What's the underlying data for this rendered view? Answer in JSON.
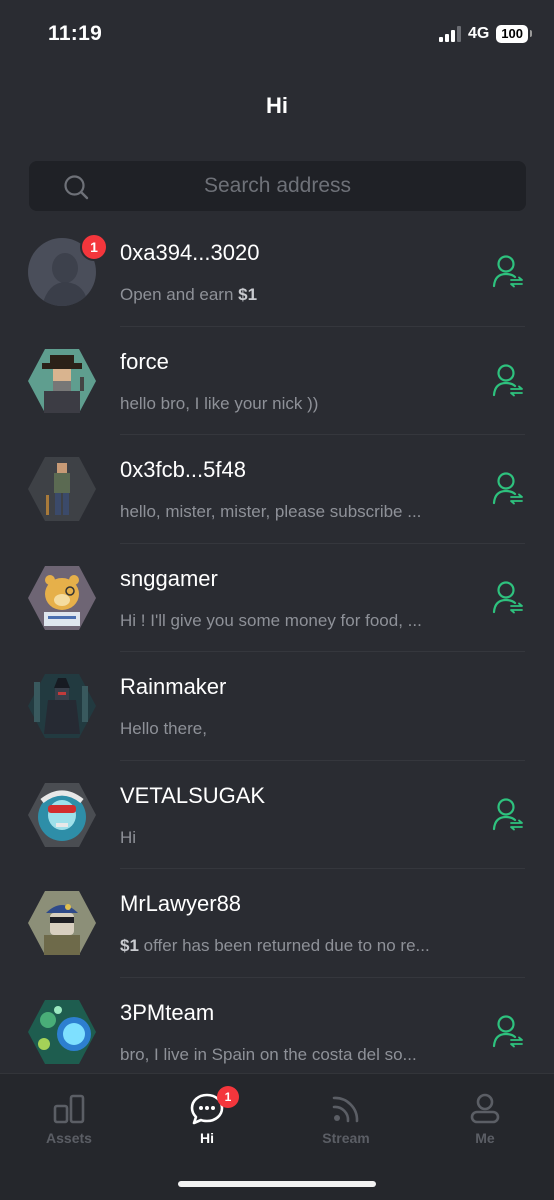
{
  "status": {
    "time": "11:19",
    "network": "4G",
    "battery": "100"
  },
  "header": {
    "title": "Hi"
  },
  "search": {
    "placeholder": "Search address"
  },
  "chats": [
    {
      "name": "0xa394...3020",
      "preview_prefix": "Open and earn ",
      "preview_bold": "$1",
      "preview_suffix": "",
      "badge": "1",
      "follow": true
    },
    {
      "name": "force",
      "preview_prefix": "hello bro, I like your nick ))",
      "preview_bold": "",
      "preview_suffix": "",
      "badge": "",
      "follow": true
    },
    {
      "name": "0x3fcb...5f48",
      "preview_prefix": "hello, mister, mister, please subscribe ...",
      "preview_bold": "",
      "preview_suffix": "",
      "badge": "",
      "follow": true
    },
    {
      "name": "snggamer",
      "preview_prefix": "Hi ! I'll give you some money for food, ...",
      "preview_bold": "",
      "preview_suffix": "",
      "badge": "",
      "follow": true
    },
    {
      "name": "Rainmaker",
      "preview_prefix": "Hello there,",
      "preview_bold": "",
      "preview_suffix": "",
      "badge": "",
      "follow": false
    },
    {
      "name": "VETALSUGAK",
      "preview_prefix": "Hi",
      "preview_bold": "",
      "preview_suffix": "",
      "badge": "",
      "follow": true
    },
    {
      "name": "MrLawyer88",
      "preview_prefix": "",
      "preview_bold": "$1",
      "preview_suffix": " offer has been returned due to no re...",
      "badge": "",
      "follow": false
    },
    {
      "name": "3PMteam",
      "preview_prefix": "bro, I live in Spain on the costa del so...",
      "preview_bold": "",
      "preview_suffix": "",
      "badge": "",
      "follow": true
    }
  ],
  "nav": {
    "assets": "Assets",
    "hi": "Hi",
    "hi_badge": "1",
    "stream": "Stream",
    "me": "Me"
  },
  "colors": {
    "accent_green": "#2ec27e",
    "badge_red": "#f4363c",
    "background": "#2a2c32"
  }
}
